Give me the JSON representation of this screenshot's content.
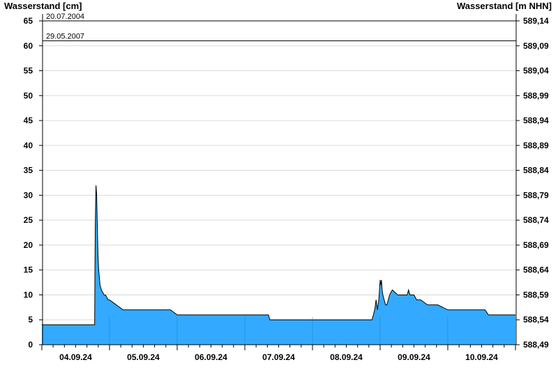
{
  "chart_data": {
    "type": "area",
    "left_axis_title": "Wasserstand [cm]",
    "right_axis_title": "Wasserstand [m NHN]",
    "ylim": [
      0,
      65
    ],
    "y_ticks": [
      0,
      5,
      10,
      15,
      20,
      25,
      30,
      35,
      40,
      45,
      50,
      55,
      60,
      65
    ],
    "y2_ticks": [
      "588,49",
      "588,54",
      "588,59",
      "588,64",
      "588,69",
      "588,74",
      "588,79",
      "588,84",
      "588,89",
      "588,94",
      "588,99",
      "589,04",
      "589,09",
      "589,14"
    ],
    "x_day_labels": [
      "04.09.24",
      "05.09.24",
      "06.09.24",
      "07.09.24",
      "08.09.24",
      "09.09.24",
      "10.09.24"
    ],
    "x_range_days": [
      0,
      7
    ],
    "reference_lines": [
      {
        "label": "20.07.2004",
        "value": 65
      },
      {
        "label": "29.05.2007",
        "value": 61
      }
    ],
    "fill_color": "#33aaff",
    "line_color": "#000000",
    "series": [
      {
        "x": [
          0,
          0.78,
          0.785,
          0.79,
          0.8,
          0.81,
          0.82,
          0.83,
          0.84,
          0.86,
          0.88,
          0.9,
          0.92,
          0.94,
          0.96,
          0.98,
          1.0,
          1.05,
          1.1,
          1.2,
          1.3,
          1.6,
          1.9,
          2.0,
          2.5,
          3.0,
          3.35,
          3.36,
          3.37,
          3.4,
          3.7,
          4.0,
          4.5,
          4.88,
          4.9,
          4.92,
          4.93,
          4.94,
          4.95,
          4.96,
          4.98,
          5.0,
          5.01,
          5.02,
          5.03,
          5.04,
          5.06,
          5.08,
          5.1,
          5.12,
          5.14,
          5.16,
          5.18,
          5.22,
          5.26,
          5.3,
          5.4,
          5.42,
          5.44,
          5.5,
          5.52,
          5.54,
          5.56,
          5.6,
          5.7,
          5.85,
          6.0,
          6.5,
          6.55,
          6.6,
          7.0
        ],
        "values": [
          4,
          4,
          15,
          24,
          32,
          30,
          24,
          18,
          15,
          12,
          11,
          10.5,
          10,
          10,
          9.5,
          9,
          9,
          8.5,
          8,
          7,
          7,
          7,
          7,
          6,
          6,
          6,
          6,
          5.5,
          5,
          5,
          5,
          5,
          5,
          5,
          6,
          7,
          8,
          9,
          8,
          7,
          9,
          13,
          12,
          13,
          11,
          10,
          9,
          8,
          8,
          9,
          10,
          10.5,
          11,
          10.5,
          10,
          10,
          10,
          11,
          10,
          10,
          9.5,
          9,
          9,
          9,
          8,
          8,
          7,
          7,
          7,
          6,
          6
        ]
      }
    ]
  }
}
